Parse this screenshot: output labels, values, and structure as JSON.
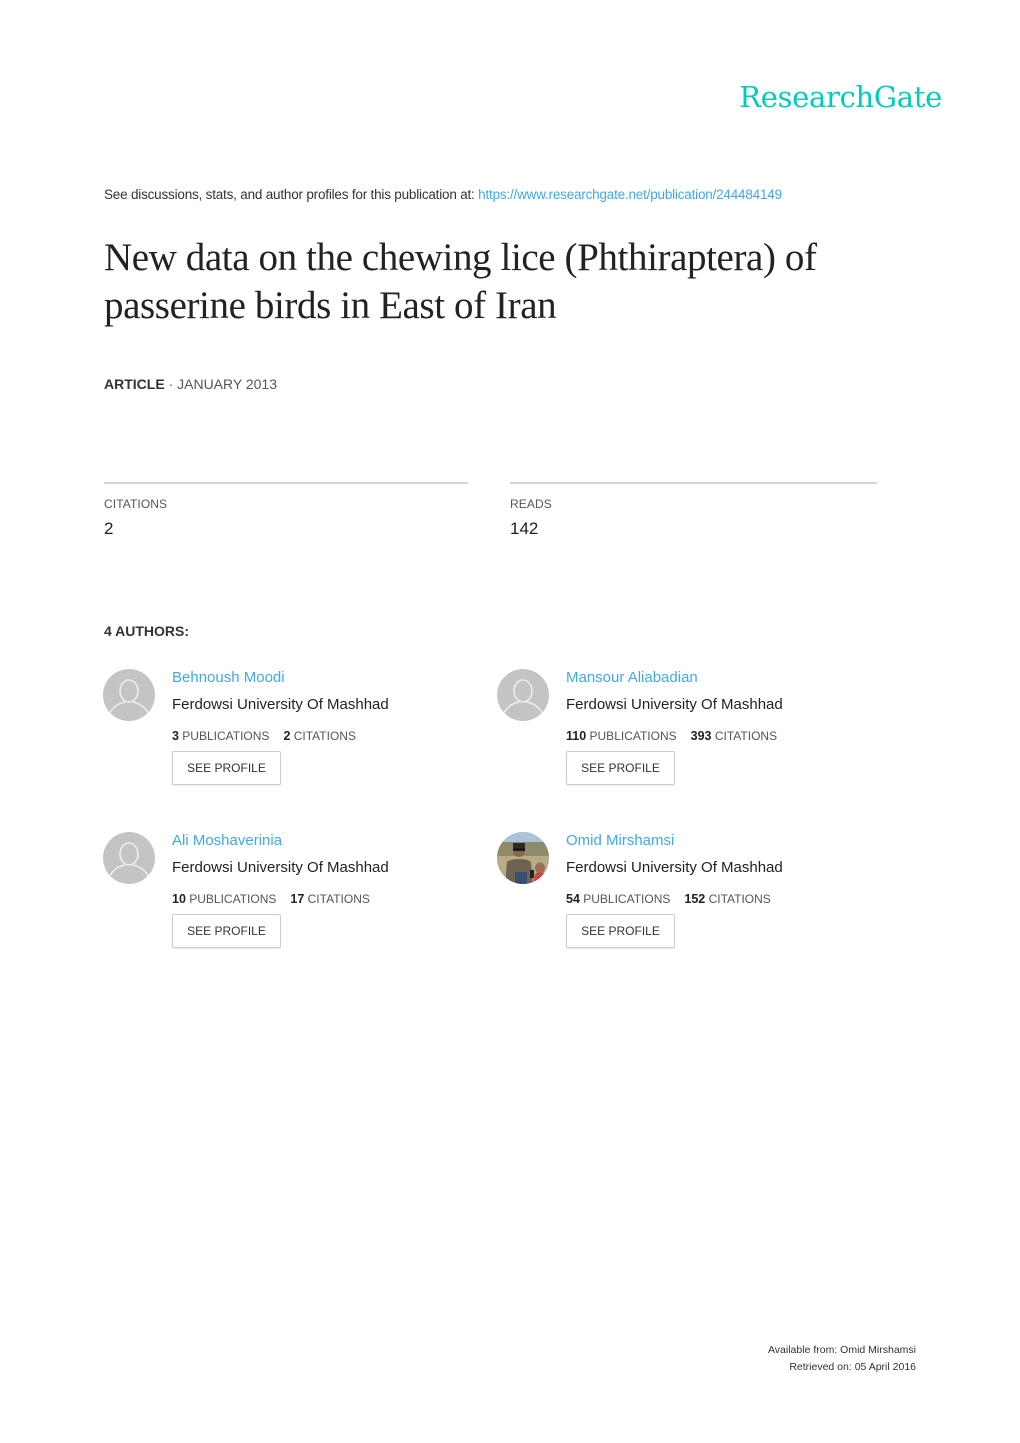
{
  "brand": {
    "logo_text": "ResearchGate",
    "logo_color": "#00ccbb",
    "link_color": "#40a9e8"
  },
  "discussion": {
    "prefix": "See discussions, stats, and author profiles for this publication at: ",
    "url_text": "https://www.researchgate.net/publication/244484149"
  },
  "publication": {
    "title": "New data on the chewing lice (Phthiraptera) of passerine birds in East of Iran",
    "type": "ARTICLE",
    "separator": " · ",
    "date": "JANUARY 2013"
  },
  "stats": {
    "citations_label": "CITATIONS",
    "citations_value": "2",
    "reads_label": "READS",
    "reads_value": "142"
  },
  "authors_heading": "4 AUTHORS:",
  "authors": [
    {
      "name": "Behnoush Moodi",
      "institution": "Ferdowsi University Of Mashhad",
      "publications": "3",
      "publications_label": "PUBLICATIONS",
      "citations": "2",
      "citations_label": "CITATIONS",
      "button_label": "SEE PROFILE",
      "avatar": "default-avatar-icon"
    },
    {
      "name": "Mansour Aliabadian",
      "institution": "Ferdowsi University Of Mashhad",
      "publications": "110",
      "publications_label": "PUBLICATIONS",
      "citations": "393",
      "citations_label": "CITATIONS",
      "button_label": "SEE PROFILE",
      "avatar": "default-avatar-icon"
    },
    {
      "name": "Ali Moshaverinia",
      "institution": "Ferdowsi University Of Mashhad",
      "publications": "10",
      "publications_label": "PUBLICATIONS",
      "citations": "17",
      "citations_label": "CITATIONS",
      "button_label": "SEE PROFILE",
      "avatar": "default-avatar-icon"
    },
    {
      "name": "Omid Mirshamsi",
      "institution": "Ferdowsi University Of Mashhad",
      "publications": "54",
      "publications_label": "PUBLICATIONS",
      "citations": "152",
      "citations_label": "CITATIONS",
      "button_label": "SEE PROFILE",
      "avatar": "profile-photo"
    }
  ],
  "footer": {
    "available_from": "Available from: Omid Mirshamsi",
    "retrieved_on": "Retrieved on: 05 April 2016"
  }
}
